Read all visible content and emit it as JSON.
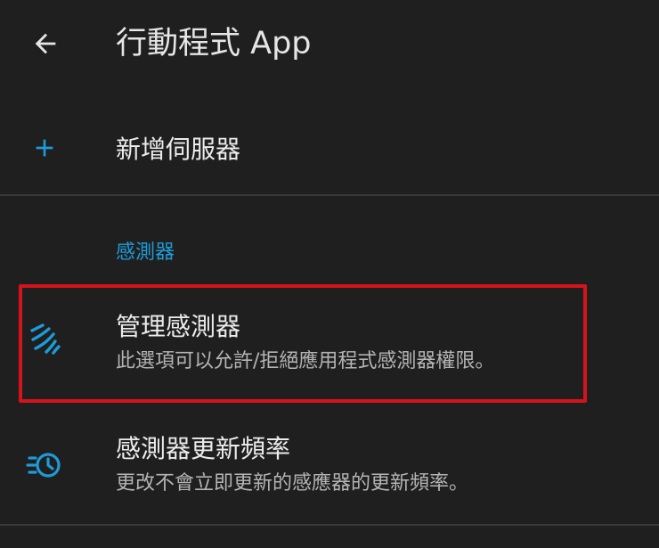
{
  "appbar": {
    "back_icon": "arrow-back-icon",
    "title": "行動程式 App"
  },
  "add_server": {
    "icon": "plus-icon",
    "label": "新增伺服器"
  },
  "sensors_section": {
    "header": "感測器",
    "items": [
      {
        "icon": "sensor-waves-icon",
        "title": "管理感測器",
        "summary": "此選項可以允許/拒絕應用程式感測器權限。",
        "highlighted": true
      },
      {
        "icon": "update-clock-icon",
        "title": "感測器更新頻率",
        "summary": "更改不會立即更新的感應器的更新頻率。"
      }
    ]
  },
  "colors": {
    "background": "#1f1f1f",
    "accent": "#1e9bd7",
    "highlight_border": "#d4141a",
    "divider": "#3a3a3a"
  }
}
